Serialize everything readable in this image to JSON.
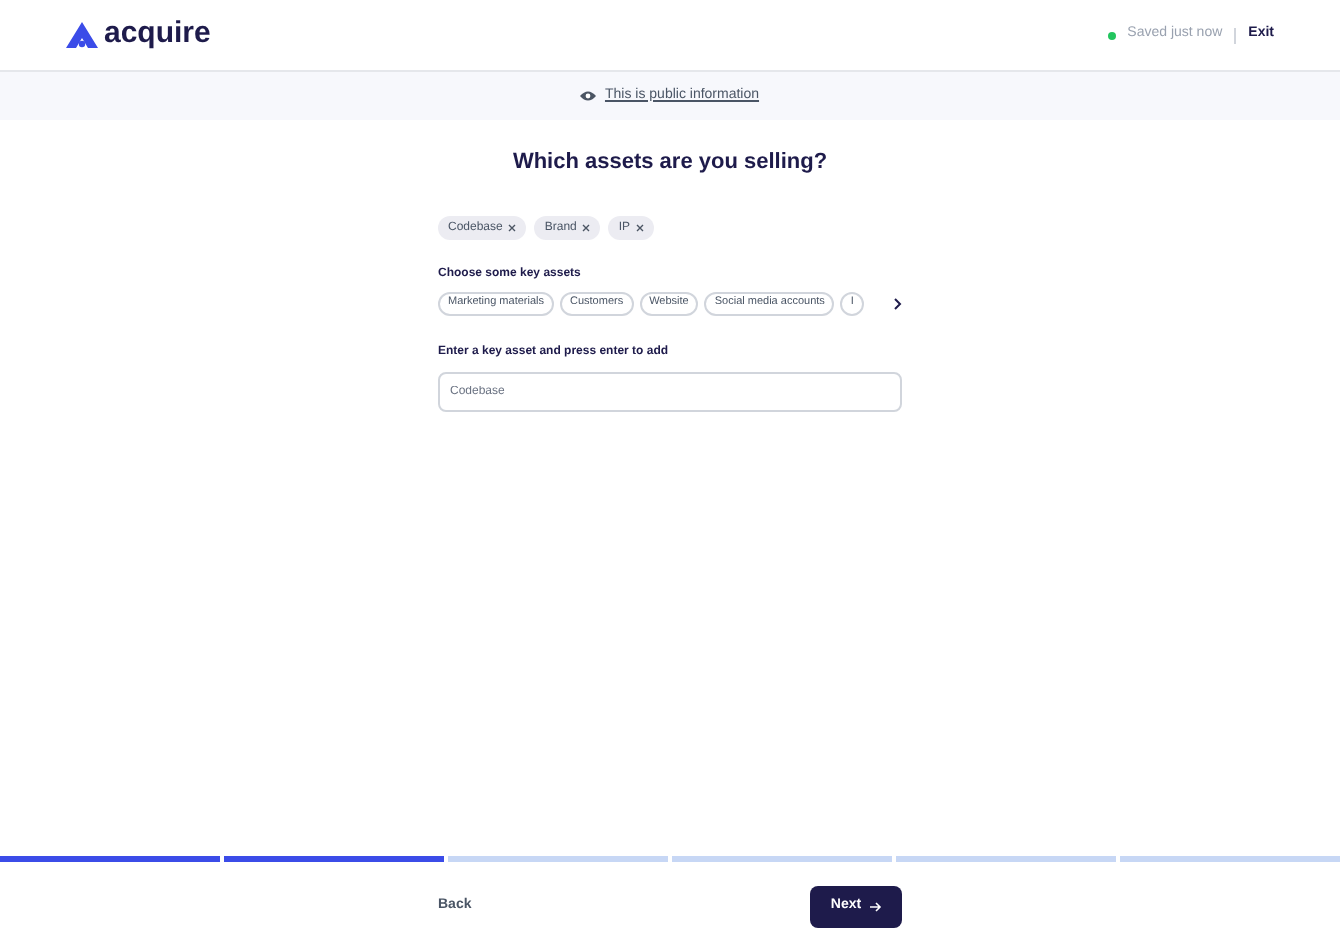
{
  "header": {
    "logo": "acquire",
    "status": "Saved just now",
    "exit": "Exit"
  },
  "banner": {
    "text": "This is public information"
  },
  "title": "Which assets are you selling?",
  "selected_assets": [
    "Codebase",
    "Brand",
    "IP"
  ],
  "suggestions": {
    "label": "Choose some key assets",
    "items": [
      "Marketing materials",
      "Customers",
      "Website",
      "Social media accounts",
      "I"
    ]
  },
  "input": {
    "label": "Enter a key asset and press enter to add",
    "placeholder": "Codebase"
  },
  "progress": [
    {
      "done": true
    },
    {
      "done": true
    },
    {
      "done": false
    },
    {
      "done": false
    },
    {
      "done": false
    },
    {
      "done": false
    }
  ],
  "footer": {
    "back": "Back",
    "next": "Next"
  }
}
